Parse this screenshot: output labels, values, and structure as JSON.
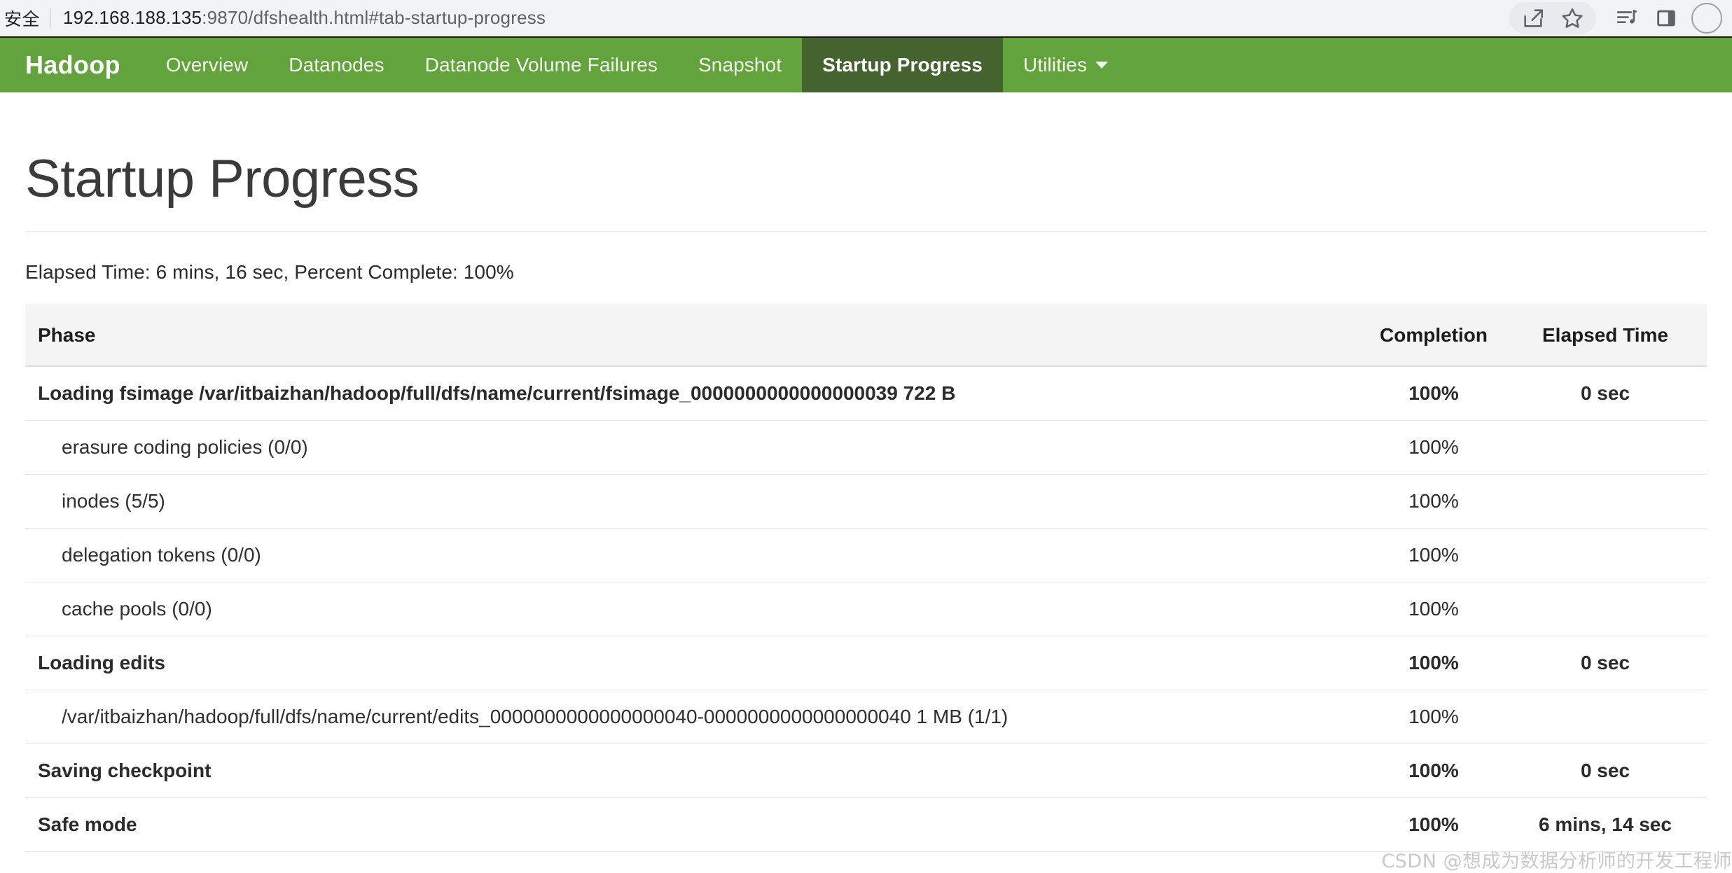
{
  "browser": {
    "security_label": "安全",
    "url_prefix": "192.168.188.135",
    "url_suffix": ":9870/dfshealth.html#tab-startup-progress",
    "actions": [
      {
        "name": "share-icon",
        "label": "Share"
      },
      {
        "name": "star-icon",
        "label": "Bookmark"
      },
      {
        "name": "media-playlist-icon",
        "label": "Media"
      },
      {
        "name": "side-panel-icon",
        "label": "Side panel"
      },
      {
        "name": "profile-avatar",
        "label": "Profile"
      }
    ]
  },
  "navbar": {
    "brand": "Hadoop",
    "accent_color": "#63a33c",
    "active_color": "#44632e",
    "items": [
      {
        "label": "Overview",
        "active": false
      },
      {
        "label": "Datanodes",
        "active": false
      },
      {
        "label": "Datanode Volume Failures",
        "active": false
      },
      {
        "label": "Snapshot",
        "active": false
      },
      {
        "label": "Startup Progress",
        "active": true
      },
      {
        "label": "Utilities",
        "active": false,
        "dropdown": true
      }
    ]
  },
  "page": {
    "title": "Startup Progress",
    "summary": "Elapsed Time: 6 mins, 16 sec, Percent Complete: 100%",
    "elapsed_time": "6 mins, 16 sec",
    "percent_complete": "100%"
  },
  "table": {
    "columns": [
      "Phase",
      "Completion",
      "Elapsed Time"
    ],
    "rows": [
      {
        "type": "phase",
        "phase": "Loading fsimage /var/itbaizhan/hadoop/full/dfs/name/current/fsimage_0000000000000000039 722 B",
        "completion": "100%",
        "elapsed": "0 sec"
      },
      {
        "type": "step",
        "phase": "erasure coding policies (0/0)",
        "completion": "100%",
        "elapsed": ""
      },
      {
        "type": "step",
        "phase": "inodes (5/5)",
        "completion": "100%",
        "elapsed": ""
      },
      {
        "type": "step",
        "phase": "delegation tokens (0/0)",
        "completion": "100%",
        "elapsed": ""
      },
      {
        "type": "step",
        "phase": "cache pools (0/0)",
        "completion": "100%",
        "elapsed": ""
      },
      {
        "type": "phase",
        "phase": "Loading edits",
        "completion": "100%",
        "elapsed": "0 sec"
      },
      {
        "type": "step",
        "phase": "/var/itbaizhan/hadoop/full/dfs/name/current/edits_0000000000000000040-0000000000000000040 1 MB (1/1)",
        "completion": "100%",
        "elapsed": ""
      },
      {
        "type": "phase",
        "phase": "Saving checkpoint",
        "completion": "100%",
        "elapsed": "0 sec"
      },
      {
        "type": "phase",
        "phase": "Safe mode",
        "completion": "100%",
        "elapsed": "6 mins, 14 sec"
      }
    ]
  },
  "watermark": "CSDN @想成为数据分析师的开发工程师"
}
